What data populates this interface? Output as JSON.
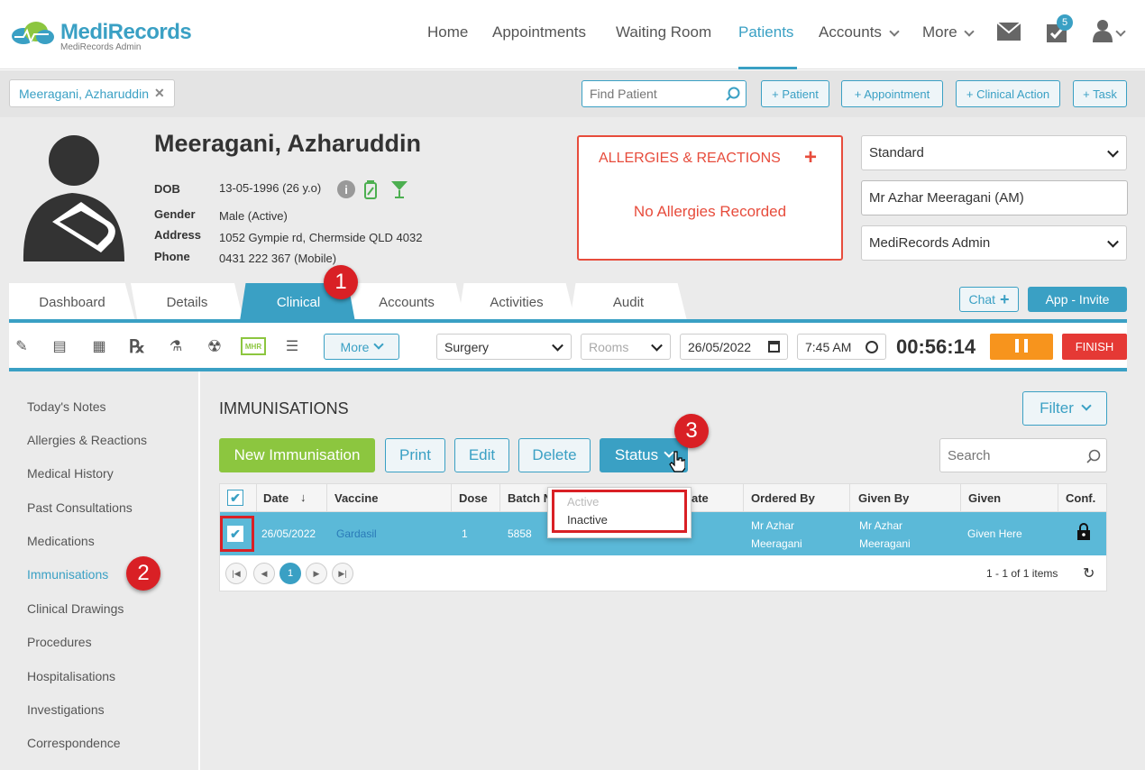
{
  "header": {
    "logo": "MediRecords",
    "logo_sub": "MediRecords Admin",
    "nav": [
      "Home",
      "Appointments",
      "Waiting Room",
      "Patients",
      "Accounts",
      "More"
    ],
    "tasks_count": "5"
  },
  "patientbar": {
    "open_patient": "Meeragani, Azharuddin",
    "find_placeholder": "Find Patient",
    "buttons": [
      "+ Patient",
      "+ Appointment",
      "+ Clinical Action",
      "+ Task"
    ]
  },
  "patient": {
    "name": "Meeragani, Azharuddin",
    "dob_label": "DOB",
    "dob": "13-05-1996 (26 y.o)",
    "gender_label": "Gender",
    "gender": "Male (Active)",
    "address_label": "Address",
    "address": "1052 Gympie rd, Chermside QLD 4032",
    "phone_label": "Phone",
    "phone": "0431 222 367 (Mobile)"
  },
  "allergies": {
    "title": "ALLERGIES & REACTIONS",
    "message": "No Allergies Recorded"
  },
  "selectors": {
    "type": "Standard",
    "practitioner": "Mr Azhar Meeragani (AM)",
    "location": "MediRecords Admin"
  },
  "tabs": [
    "Dashboard",
    "Details",
    "Clinical",
    "Accounts",
    "Activities",
    "Audit"
  ],
  "chat": "Chat",
  "app_invite": "App - Invite",
  "toolbar": {
    "more": "More",
    "surgery": "Surgery",
    "rooms_placeholder": "Rooms",
    "date": "26/05/2022",
    "time": "7:45 AM",
    "timer": "00:56:14",
    "finish": "FINISH"
  },
  "sidebar": [
    "Today's Notes",
    "Allergies & Reactions",
    "Medical History",
    "Past Consultations",
    "Medications",
    "Immunisations",
    "Clinical Drawings",
    "Procedures",
    "Hospitalisations",
    "Investigations",
    "Correspondence"
  ],
  "immunisations": {
    "title": "IMMUNISATIONS",
    "filter": "Filter",
    "new_label": "New Immunisation",
    "print": "Print",
    "edit": "Edit",
    "delete": "Delete",
    "status": "Status",
    "search_placeholder": "Search",
    "status_options": [
      "Active",
      "Inactive"
    ],
    "columns": [
      "Date",
      "Vaccine",
      "Dose",
      "Batch N",
      "ate",
      "Ordered By",
      "Given By",
      "Given",
      "Conf."
    ],
    "row": {
      "date": "26/05/2022",
      "vaccine": "Gardasil",
      "dose": "1",
      "batch": "5858",
      "ordered_by": "Mr Azhar Meeragani",
      "given_by": "Mr Azhar Meeragani",
      "given": "Given Here"
    },
    "page": "1",
    "items_info": "1 - 1 of 1 items"
  },
  "annotations": [
    "1",
    "2",
    "3"
  ],
  "colors": {
    "accent": "#3aa0c4",
    "green": "#8cc63f",
    "orange": "#f7941d",
    "red": "#e53935",
    "allergy_red": "#e74c3c"
  }
}
